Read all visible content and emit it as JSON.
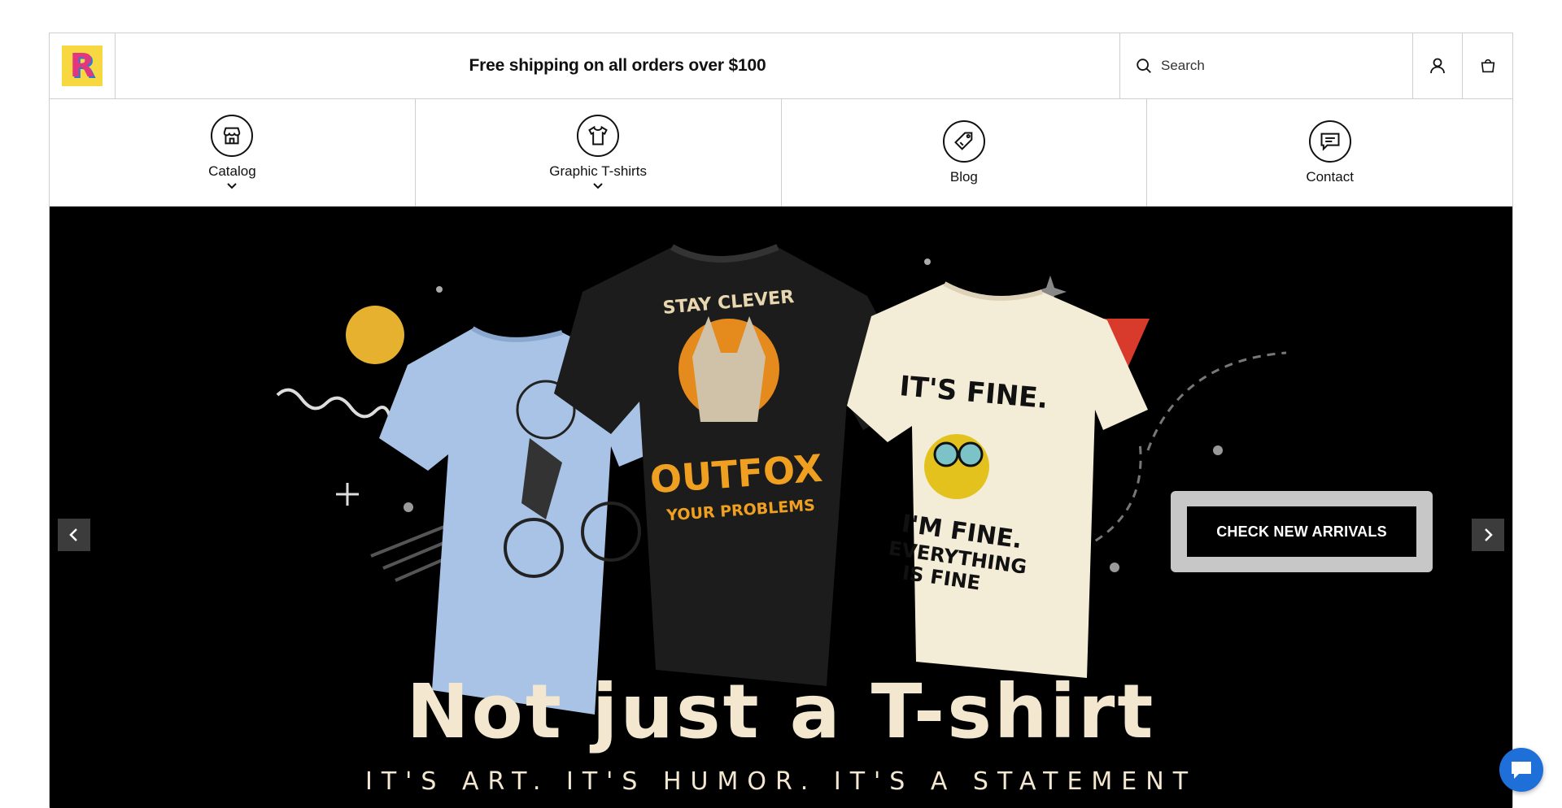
{
  "header": {
    "logo_icon": "rainbow-letter-r-logo",
    "promo_text": "Free shipping on all orders over $100",
    "search_placeholder": "Search",
    "account_icon": "user-icon",
    "cart_icon": "shopping-bag-icon"
  },
  "nav": {
    "items": [
      {
        "label": "Catalog",
        "icon": "storefront-icon",
        "has_dropdown": true
      },
      {
        "label": "Graphic T-shirts",
        "icon": "tshirt-icon",
        "has_dropdown": true
      },
      {
        "label": "Blog",
        "icon": "tag-icon",
        "has_dropdown": false
      },
      {
        "label": "Contact",
        "icon": "chat-bubble-icon",
        "has_dropdown": false
      }
    ]
  },
  "hero": {
    "headline": "Not just a T-shirt",
    "tagline": "IT'S ART. IT'S HUMOR. IT'S A STATEMENT",
    "cta_label": "CHECK NEW ARRIVALS",
    "shirts": [
      {
        "color": "light-blue",
        "print_text": ""
      },
      {
        "color": "black",
        "print_text_top": "STAY CLEVER",
        "print_text_main": "OUTFOX",
        "print_text_sub": "YOUR PROBLEMS"
      },
      {
        "color": "cream",
        "print_text_top": "IT'S FINE.",
        "print_text_main": "I'M FINE.",
        "print_text_sub": "EVERYTHING IS FINE"
      }
    ],
    "prev_icon": "chevron-left-icon",
    "next_icon": "chevron-right-icon"
  },
  "chat_widget": {
    "icon": "chat-icon"
  },
  "colors": {
    "hero_bg": "#000000",
    "headline": "#f3e8cf",
    "logo_bg": "#f7d840",
    "chat": "#1f6fd8",
    "accent_yellow": "#e5b12f",
    "accent_red": "#d83a2c"
  }
}
